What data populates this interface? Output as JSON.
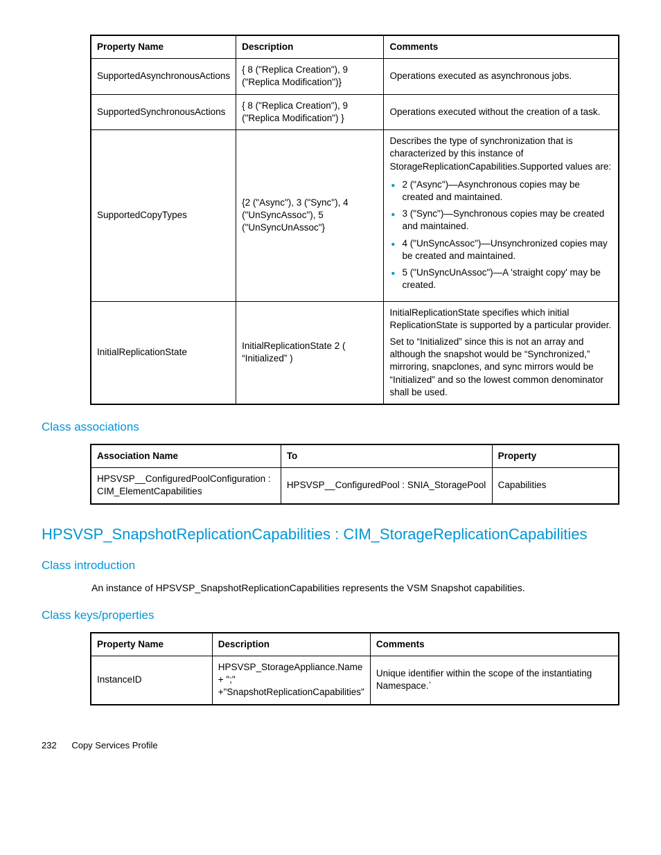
{
  "table1": {
    "headers": [
      "Property Name",
      "Description",
      "Comments"
    ],
    "rows": [
      {
        "prop": "SupportedAsynchronousActions",
        "desc": "{ 8 (\"Replica Creation\"), 9 (\"Replica Modification\")}",
        "comments": "Operations executed as asynchronous jobs."
      },
      {
        "prop": "SupportedSynchronousActions",
        "desc": "{ 8 (\"Replica Creation\"), 9 (\"Replica Modification\") }",
        "comments": "Operations executed without the creation of a task."
      },
      {
        "prop": "SupportedCopyTypes",
        "desc": "{2 (\"Async\"), 3 (\"Sync\"), 4 (\"UnSyncAssoc\"), 5 (\"UnSyncUnAssoc\"}",
        "comments_intro": "Describes the type of synchronization that is characterized by this instance of StorageReplicationCapabilities.Supported values are:",
        "bullets": [
          "2 (\"Async\")—Asynchronous copies may be created and maintained.",
          "3 (\"Sync\")—Synchronous copies may be created and maintained.",
          "4 (\"UnSyncAssoc\")—Unsynchronized copies may be created and maintained.",
          "5 (\"UnSyncUnAssoc\")—A 'straight copy' may be created."
        ]
      },
      {
        "prop": "InitialReplicationState",
        "desc": "InitialReplicationState 2 ( “Initialized” )",
        "comments_p1": "InitialReplicationState specifies which initial ReplicationState is supported by a particular provider.",
        "comments_p2": "Set to “Initialized” since this is not an array and although the snapshot would be “Synchronized,” mirroring, snapclones, and sync mirrors would be “Initialized” and so the lowest common denominator shall be used."
      }
    ]
  },
  "sections": {
    "class_assoc": "Class associations",
    "main_heading": "HPSVSP_SnapshotReplicationCapabilities : CIM_StorageReplicationCapabilities",
    "class_intro": "Class introduction",
    "intro_text": "An instance of HPSVSP_SnapshotReplicationCapabilities represents the VSM Snapshot capabilities.",
    "class_keys": "Class keys/properties"
  },
  "table2": {
    "headers": [
      "Association Name",
      "To",
      "Property"
    ],
    "row": {
      "assoc": "HPSVSP__ConfiguredPoolConfiguration : CIM_ElementCapabilities",
      "to": "HPSVSP__ConfiguredPool : SNIA_StoragePool",
      "prop": "Capabilities"
    }
  },
  "table3": {
    "headers": [
      "Property Name",
      "Description",
      "Comments"
    ],
    "row": {
      "prop": "InstanceID",
      "desc": "HPSVSP_StorageAppliance.Name + \";\" +\"SnapshotReplicationCapabilities\"",
      "comments": "Unique identifier within the scope of the instantiating Namespace.´"
    }
  },
  "footer": {
    "page": "232",
    "title": "Copy Services Profile"
  }
}
